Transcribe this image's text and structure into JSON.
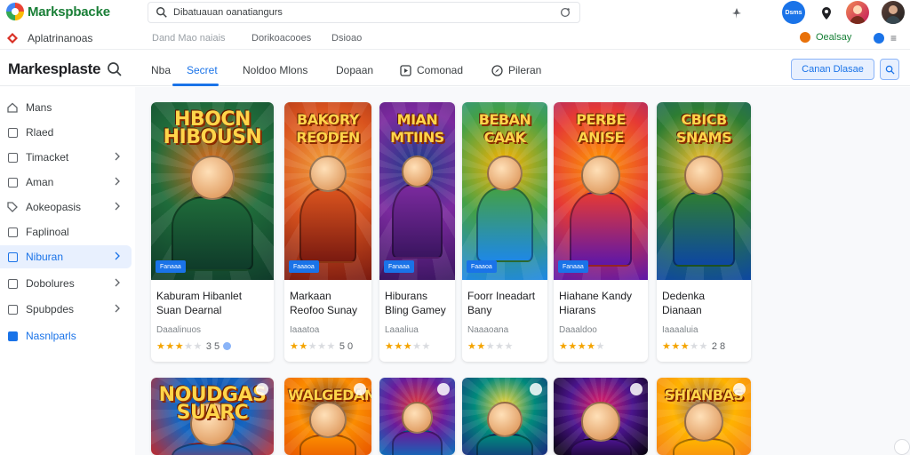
{
  "browser": {
    "app_name": "Markspbacke",
    "search_value": "Dibatuauan oanatiangurs",
    "avatar_1_label": "Dsms"
  },
  "bookmarks": {
    "first": "Aplatrinanoas",
    "item_2": "Dand Mao naiais",
    "item_3": "Dorikoacooes",
    "item_4": "Dsioao",
    "account_label": "Oealsay"
  },
  "header": {
    "brand": "Markesplaste",
    "tabs": [
      {
        "label": "Nba",
        "icon": ""
      },
      {
        "label": "Secret",
        "icon": ""
      },
      {
        "label": "Noldoo Mlons",
        "icon": ""
      },
      {
        "label": "Dopaan",
        "icon": ""
      },
      {
        "label": "Comonad",
        "icon": "play-square-icon"
      },
      {
        "label": "Pileran",
        "icon": "compass-icon"
      }
    ],
    "active_tab": 1,
    "cta_label": "Canan Dlasae"
  },
  "sidebar": {
    "items": [
      {
        "label": "Mans",
        "icon": "home-icon",
        "chevron": false
      },
      {
        "label": "Rlaed",
        "icon": "square-icon",
        "chevron": false
      },
      {
        "label": "Timacket",
        "icon": "square-icon",
        "chevron": true
      },
      {
        "label": "Aman",
        "icon": "square-icon",
        "chevron": true
      },
      {
        "label": "Aokeopasis",
        "icon": "tag-icon",
        "chevron": true
      },
      {
        "label": "Faplinoal",
        "icon": "square-icon",
        "chevron": false
      },
      {
        "label": "Niburan",
        "icon": "square-icon",
        "chevron": true
      },
      {
        "label": "Dobolures",
        "icon": "square-icon",
        "chevron": true
      },
      {
        "label": "Spubpdes",
        "icon": "square-icon",
        "chevron": true
      },
      {
        "label": "Nasnlparls",
        "icon": "checkbox-icon",
        "chevron": false
      }
    ],
    "active_index": 6,
    "selected_index": 9
  },
  "cards": [
    {
      "art_title": "HBOCN HIBOUSN",
      "badge": "Fanaaa",
      "title": "Kaburam Hibanlet Suan Dearnal",
      "meta": "Daaalinuos",
      "stars": 3,
      "count": "3 5",
      "dot": true,
      "colors": [
        "#0f3b2a",
        "#1f6b3a",
        "#e06a1a"
      ]
    },
    {
      "art_title": "BAKORY REODEN",
      "badge": "Faaaoa",
      "title": "Markaan Reofoo Sunay",
      "meta": "Iaaatoa",
      "stars": 2,
      "count": "5 0",
      "dot": false,
      "colors": [
        "#7a1a10",
        "#d9531e",
        "#f2a23c"
      ]
    },
    {
      "art_title": "MIAN MTIINS",
      "badge": "Fanaaa",
      "title": "Hiburans Bling Gamey",
      "meta": "Laaaliua",
      "stars": 3,
      "count": "",
      "dot": false,
      "colors": [
        "#3a1560",
        "#7b2a9e",
        "#1d3e8a"
      ]
    },
    {
      "art_title": "BEBAN CAAK",
      "badge": "Faaaoa",
      "title": "Foorr Ineadart Bany",
      "meta": "Naaaoana",
      "stars": 2,
      "count": "",
      "dot": false,
      "colors": [
        "#1e88e5",
        "#43a047",
        "#ffb300"
      ]
    },
    {
      "art_title": "PERBE ANISE",
      "badge": "Fanaaa",
      "title": "Hiahane Kandy Hiarans",
      "meta": "Daaaldoo",
      "stars": 4,
      "count": "",
      "dot": false,
      "colors": [
        "#5e17a8",
        "#e53935",
        "#ff9800"
      ]
    },
    {
      "art_title": "CBICB SNAMS",
      "badge": "",
      "title": "Dedenka Dianaan",
      "meta": "Iaaaaluia",
      "stars": 3,
      "count": "2 8",
      "dot": false,
      "colors": [
        "#0d47a1",
        "#2e7d32",
        "#fbc02d"
      ]
    },
    {
      "art_title": "NOUDGAS SUARC",
      "colors": [
        "#c62828",
        "#1565c0",
        "#0d47a1"
      ]
    },
    {
      "art_title": "WALGEDAN",
      "colors": [
        "#e65100",
        "#fb8c00",
        "#5d4037"
      ]
    },
    {
      "art_title": "",
      "colors": [
        "#0277bd",
        "#6a1b9a",
        "#e53935"
      ]
    },
    {
      "art_title": "",
      "colors": [
        "#1a237e",
        "#00897b",
        "#fdd835"
      ]
    },
    {
      "art_title": "",
      "colors": [
        "#000000",
        "#4a148c",
        "#e91e63"
      ]
    },
    {
      "art_title": "SHIANBAS",
      "colors": [
        "#f57f17",
        "#ffb300",
        "#8d6e63"
      ]
    }
  ]
}
